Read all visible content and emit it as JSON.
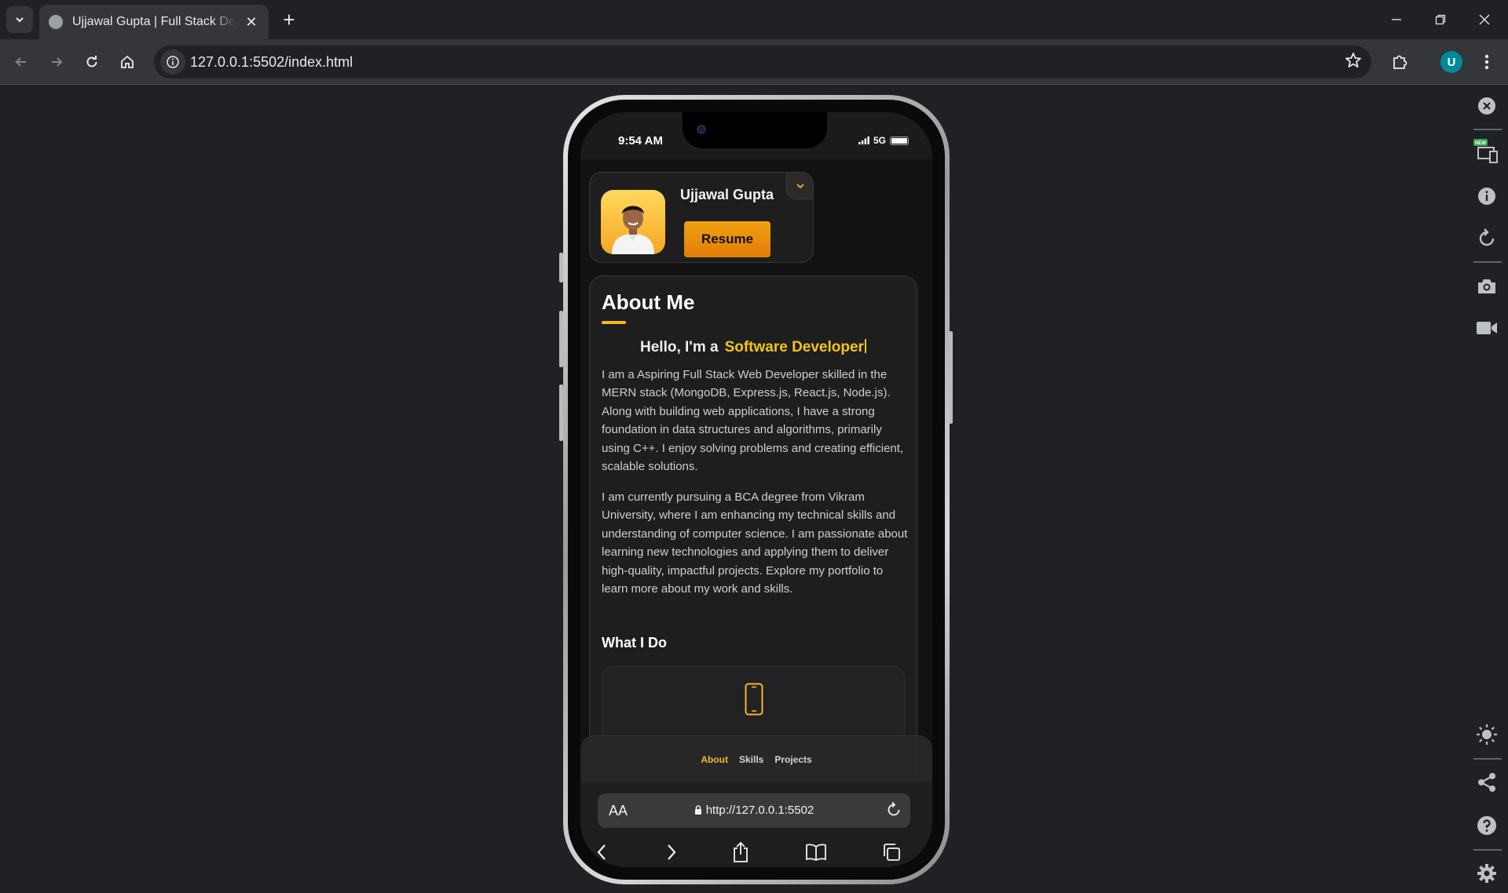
{
  "browser": {
    "tab_title": "Ujjawal Gupta | Full Stack Developer",
    "url": "127.0.0.1:5502/index.html",
    "profile_initial": "U"
  },
  "phone": {
    "status": {
      "time": "9:54 AM",
      "network": "5G"
    },
    "profile": {
      "name": "Ujjawal Gupta",
      "resume_label": "Resume"
    },
    "about": {
      "title": "About Me",
      "hello_prefix": "Hello, I'm a",
      "role": "Software Developer",
      "paragraph1": "I am a Aspiring Full Stack Web Developer skilled in the MERN stack (MongoDB, Express.js, React.js, Node.js). Along with building web applications, I have a strong foundation in data structures and algorithms, primarily using C++. I enjoy solving problems and creating efficient, scalable solutions.",
      "paragraph2": "I am currently pursuing a BCA degree from Vikram University, where I am enhancing my technical skills and understanding of computer science. I am passionate about learning new technologies and applying them to deliver high-quality, impactful projects. Explore my portfolio to learn more about my work and skills.",
      "what_i_do_title": "What I Do"
    },
    "bottom_nav": [
      "About",
      "Skills",
      "Projects"
    ],
    "safari": {
      "aa": "AA",
      "url": "http://127.0.0.1:5502"
    }
  },
  "colors": {
    "accent": "#f5b623",
    "role": "#f5c518",
    "button": "#e88c0a",
    "page_bg": "#121212",
    "card_bg": "#1e1e1f"
  },
  "devtools_rail": [
    "close-icon",
    "responsive-new-icon",
    "info-icon",
    "rotate-icon",
    "camera-icon",
    "video-icon",
    "brightness-icon",
    "share-icon",
    "help-icon",
    "settings-icon"
  ]
}
